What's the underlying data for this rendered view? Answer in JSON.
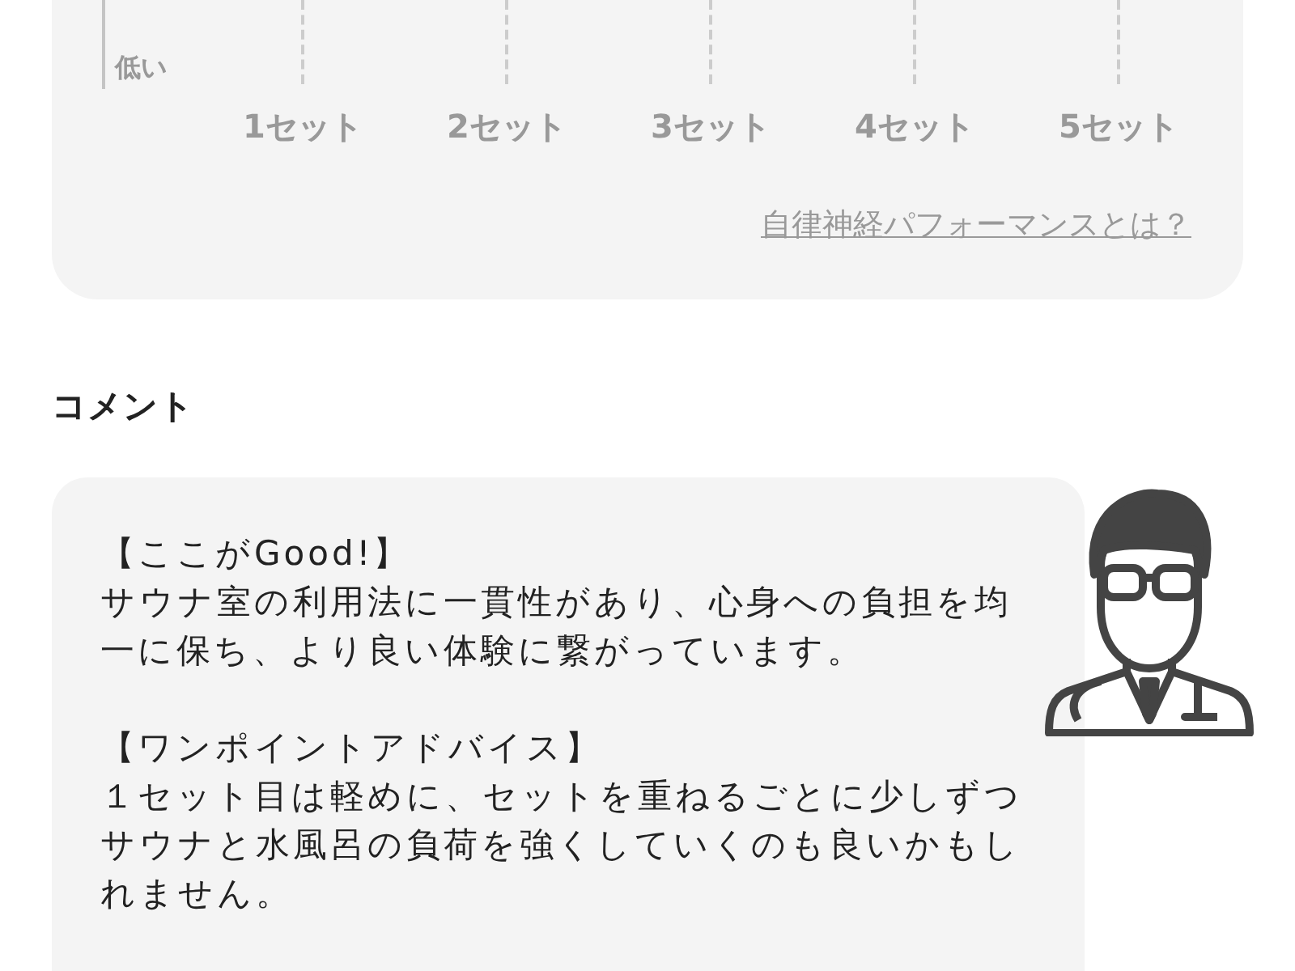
{
  "chart": {
    "y_axis_label": "低い",
    "categories": [
      "1セット",
      "2セット",
      "3セット",
      "4セット",
      "5セット"
    ],
    "link": "自律神経パフォーマンスとは？"
  },
  "comment": {
    "heading": "コメント",
    "paragraphs": [
      {
        "title": "【ここがGood!】",
        "body": "サウナ室の利用法に一貫性があり、心身への負担を均一に保ち、より良い体験に繋がっています。"
      },
      {
        "title": "【ワンポイントアドバイス】",
        "body": "１セット目は軽めに、セットを重ねるごとに少しずつサウナと水風呂の負荷を強くしていくのも良いかもしれません。"
      }
    ]
  }
}
